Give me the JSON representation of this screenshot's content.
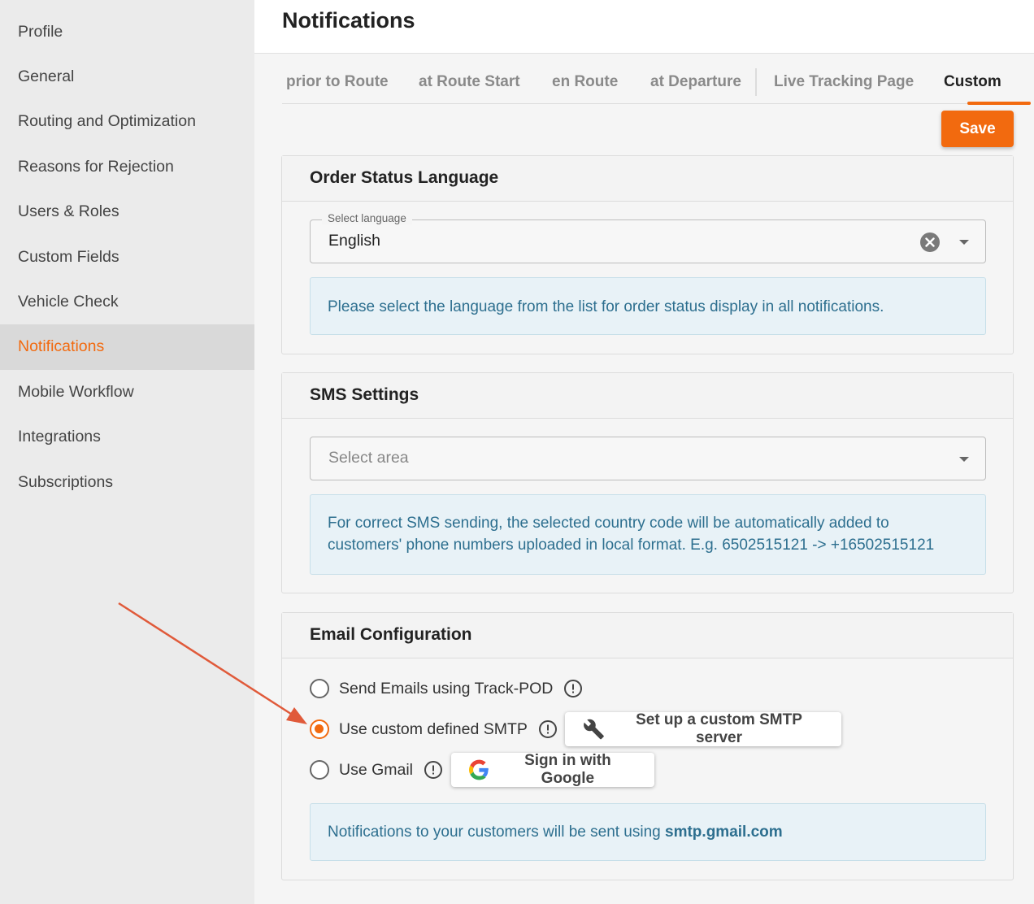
{
  "sidebar": {
    "items": [
      {
        "label": "Profile"
      },
      {
        "label": "General"
      },
      {
        "label": "Routing and Optimization"
      },
      {
        "label": "Reasons for Rejection"
      },
      {
        "label": "Users & Roles"
      },
      {
        "label": "Custom Fields"
      },
      {
        "label": "Vehicle Check"
      },
      {
        "label": "Notifications"
      },
      {
        "label": "Mobile Workflow"
      },
      {
        "label": "Integrations"
      },
      {
        "label": "Subscriptions"
      }
    ],
    "active": "Notifications"
  },
  "header": {
    "title": "Notifications"
  },
  "tabs": [
    {
      "label": "prior to Route"
    },
    {
      "label": "at Route Start"
    },
    {
      "label": "en Route"
    },
    {
      "label": "at Departure"
    },
    {
      "label": "Live Tracking Page"
    },
    {
      "label": "Custom"
    }
  ],
  "active_tab": "Custom",
  "save_label": "Save",
  "order_status": {
    "title": "Order Status Language",
    "select_label": "Select language",
    "select_value": "English",
    "info": "Please select the language from the list for order status display in all notifications."
  },
  "sms": {
    "title": "SMS Settings",
    "select_placeholder": "Select area",
    "info_line1": "For correct SMS sending, the selected country code will be automatically added to",
    "info_line2": "customers' phone numbers uploaded in local format. E.g. 6502515121 -> +16502515121"
  },
  "email": {
    "title": "Email Configuration",
    "options": [
      {
        "label": "Send Emails using Track-POD",
        "checked": false
      },
      {
        "label": "Use custom defined SMTP",
        "checked": true
      },
      {
        "label": "Use Gmail",
        "checked": false
      }
    ],
    "smtp_button": "Set up a custom SMTP server",
    "google_button": "Sign in with Google",
    "info_prefix": "Notifications to your customers will be sent using ",
    "info_server": "smtp.gmail.com"
  },
  "colors": {
    "accent": "#f26a0f",
    "info_text": "#2d6f8f",
    "info_bg": "#e8f2f7",
    "annotation_arrow": "#e05a3a"
  }
}
